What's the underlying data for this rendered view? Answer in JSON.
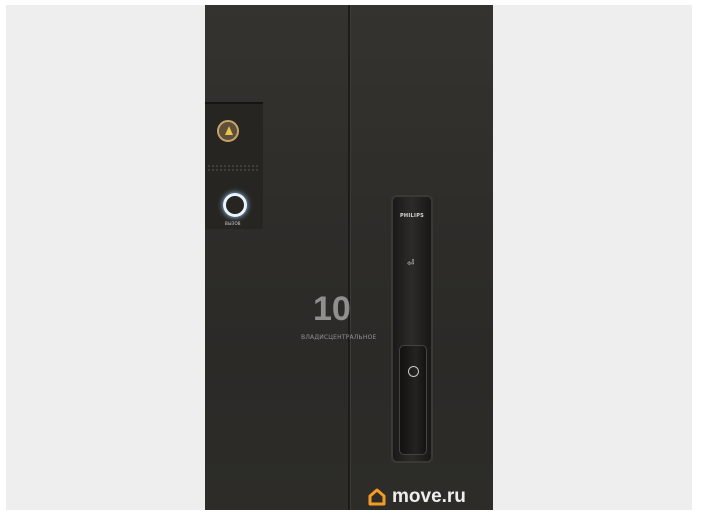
{
  "photo": {
    "brand_text": "PHILIPS",
    "call_button_label": "ВЫЗОВ",
    "unlock_glyph": "⏎"
  },
  "watermarks": {
    "agency_text": "ВЛАДИСЦЕНТРАЛЬНОЕ",
    "agency_logo_text": "10",
    "site_text": "move.ru"
  },
  "colors": {
    "background": "#eeeeee",
    "door": "#2e2d2a",
    "move_logo_accent": "#f39c23"
  }
}
